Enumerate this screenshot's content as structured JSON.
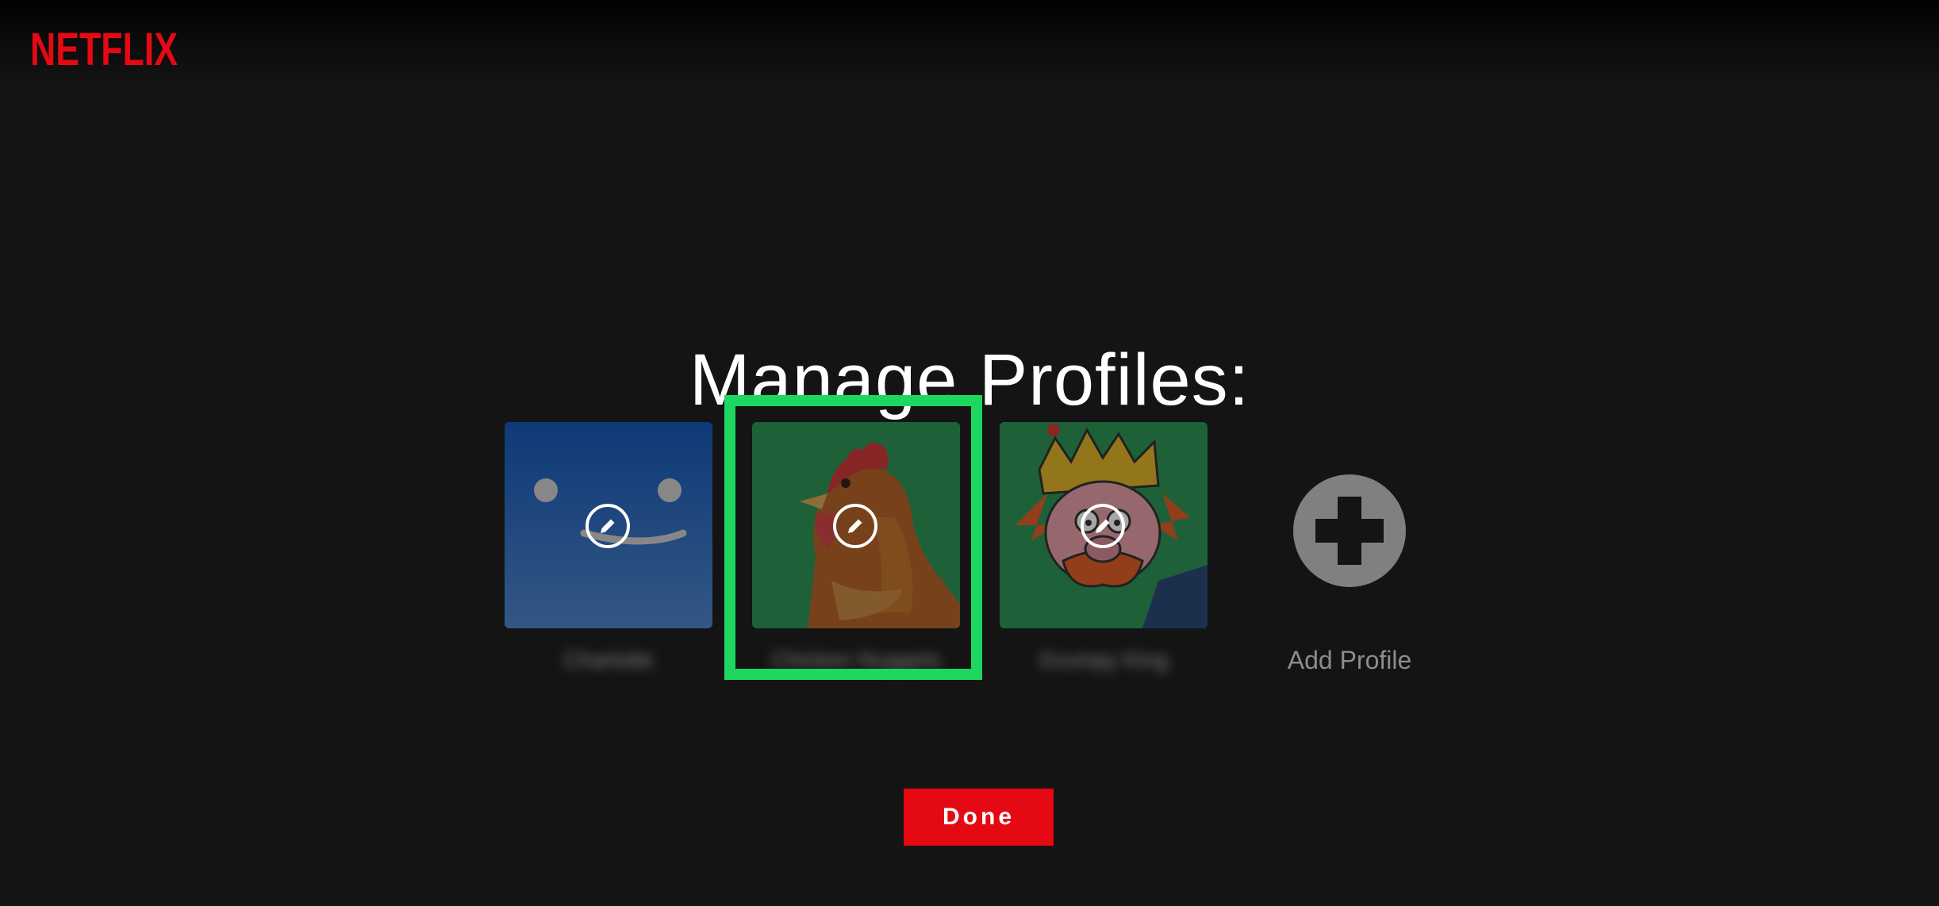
{
  "app": {
    "logo_text": "NETFLIX",
    "brand_color": "#e50914"
  },
  "page": {
    "title": "Manage Profiles:"
  },
  "profiles": [
    {
      "name": "Charlotte",
      "avatar": "blue-smiley-avatar",
      "edit_icon": "pencil-icon"
    },
    {
      "name": "Chicken Nuggets",
      "avatar": "chicken-avatar",
      "edit_icon": "pencil-icon",
      "selected": true
    },
    {
      "name": "Grumpy King",
      "avatar": "cartoon-king-avatar",
      "edit_icon": "pencil-icon"
    }
  ],
  "add_profile": {
    "label": "Add Profile",
    "icon": "plus-icon"
  },
  "actions": {
    "done_label": "Done"
  },
  "colors": {
    "background": "#141414",
    "selection_frame": "#1ed760",
    "muted_text": "#8c8c8c"
  }
}
